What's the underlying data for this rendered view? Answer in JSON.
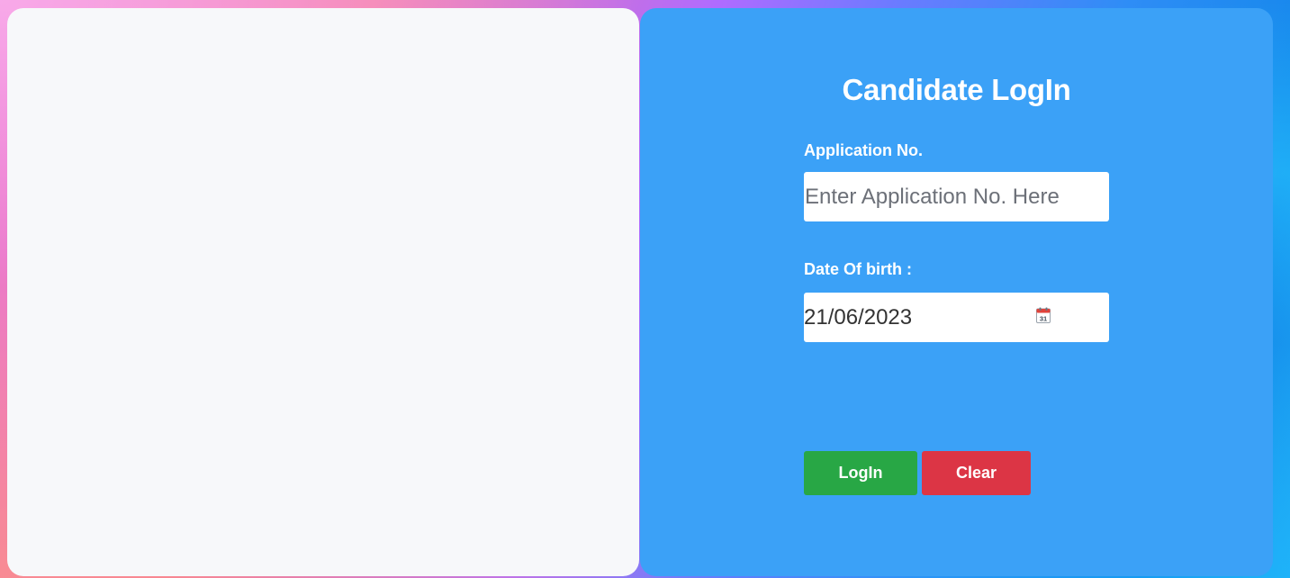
{
  "login": {
    "title": "Candidate LogIn",
    "application_label": "Application No.",
    "application_placeholder": "Enter Application No. Here",
    "application_value": "",
    "dob_label": "Date Of birth :",
    "dob_value": "21/06/2023",
    "dob_icon": "calendar-icon",
    "calendar_day": "31",
    "login_button": "LogIn",
    "clear_button": "Clear"
  },
  "colors": {
    "panel_blue": "#3ba1f7",
    "panel_light": "#f7f8fa",
    "login_green": "#28a745",
    "clear_red": "#dc3545"
  }
}
